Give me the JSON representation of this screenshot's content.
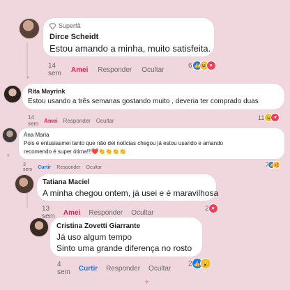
{
  "comments": [
    {
      "badge": "Superfã",
      "name": "Dirce Scheidt",
      "text": "Estou amando a minha, muito satisfeita.",
      "time": "14 sem",
      "like": "Amei",
      "reply": "Responder",
      "hide": "Ocultar",
      "count": "6"
    },
    {
      "name": "Rita Mayrink",
      "text": "Estou usando a três semanas gostando muito , deveria ter comprado duas",
      "time": "14 sem",
      "like": "Amei",
      "reply": "Responder",
      "hide": "Ocultar",
      "count": "11"
    },
    {
      "name": "Ana Maria",
      "text_line1": "Pois é entusiasmei tanto que não dei notícias chegou já estou usando e amando",
      "text_line2": "recomendo é super ótima!!!❤️👏👏👏👏",
      "time": "3 sem",
      "like": "Curtir",
      "reply": "Responder",
      "hide": "Ocultar",
      "count": "7"
    },
    {
      "name": "Tatiana Maciel",
      "text": "A minha chegou ontem, já usei e é maravilhosa",
      "time": "13 sem",
      "like": "Amei",
      "reply": "Responder",
      "hide": "Ocultar",
      "count": "2"
    },
    {
      "name": "Cristina Zovetti Giarrante",
      "text_line1": "Já uso algum tempo",
      "text_line2": "Sinto uma grande diferença no rosto",
      "time": "4 sem",
      "like": "Curtir",
      "reply": "Responder",
      "hide": "Ocultar",
      "count": "2"
    }
  ],
  "colors": {
    "background": "#efd7dd",
    "love": "#e0245e",
    "like": "#1877f2"
  }
}
